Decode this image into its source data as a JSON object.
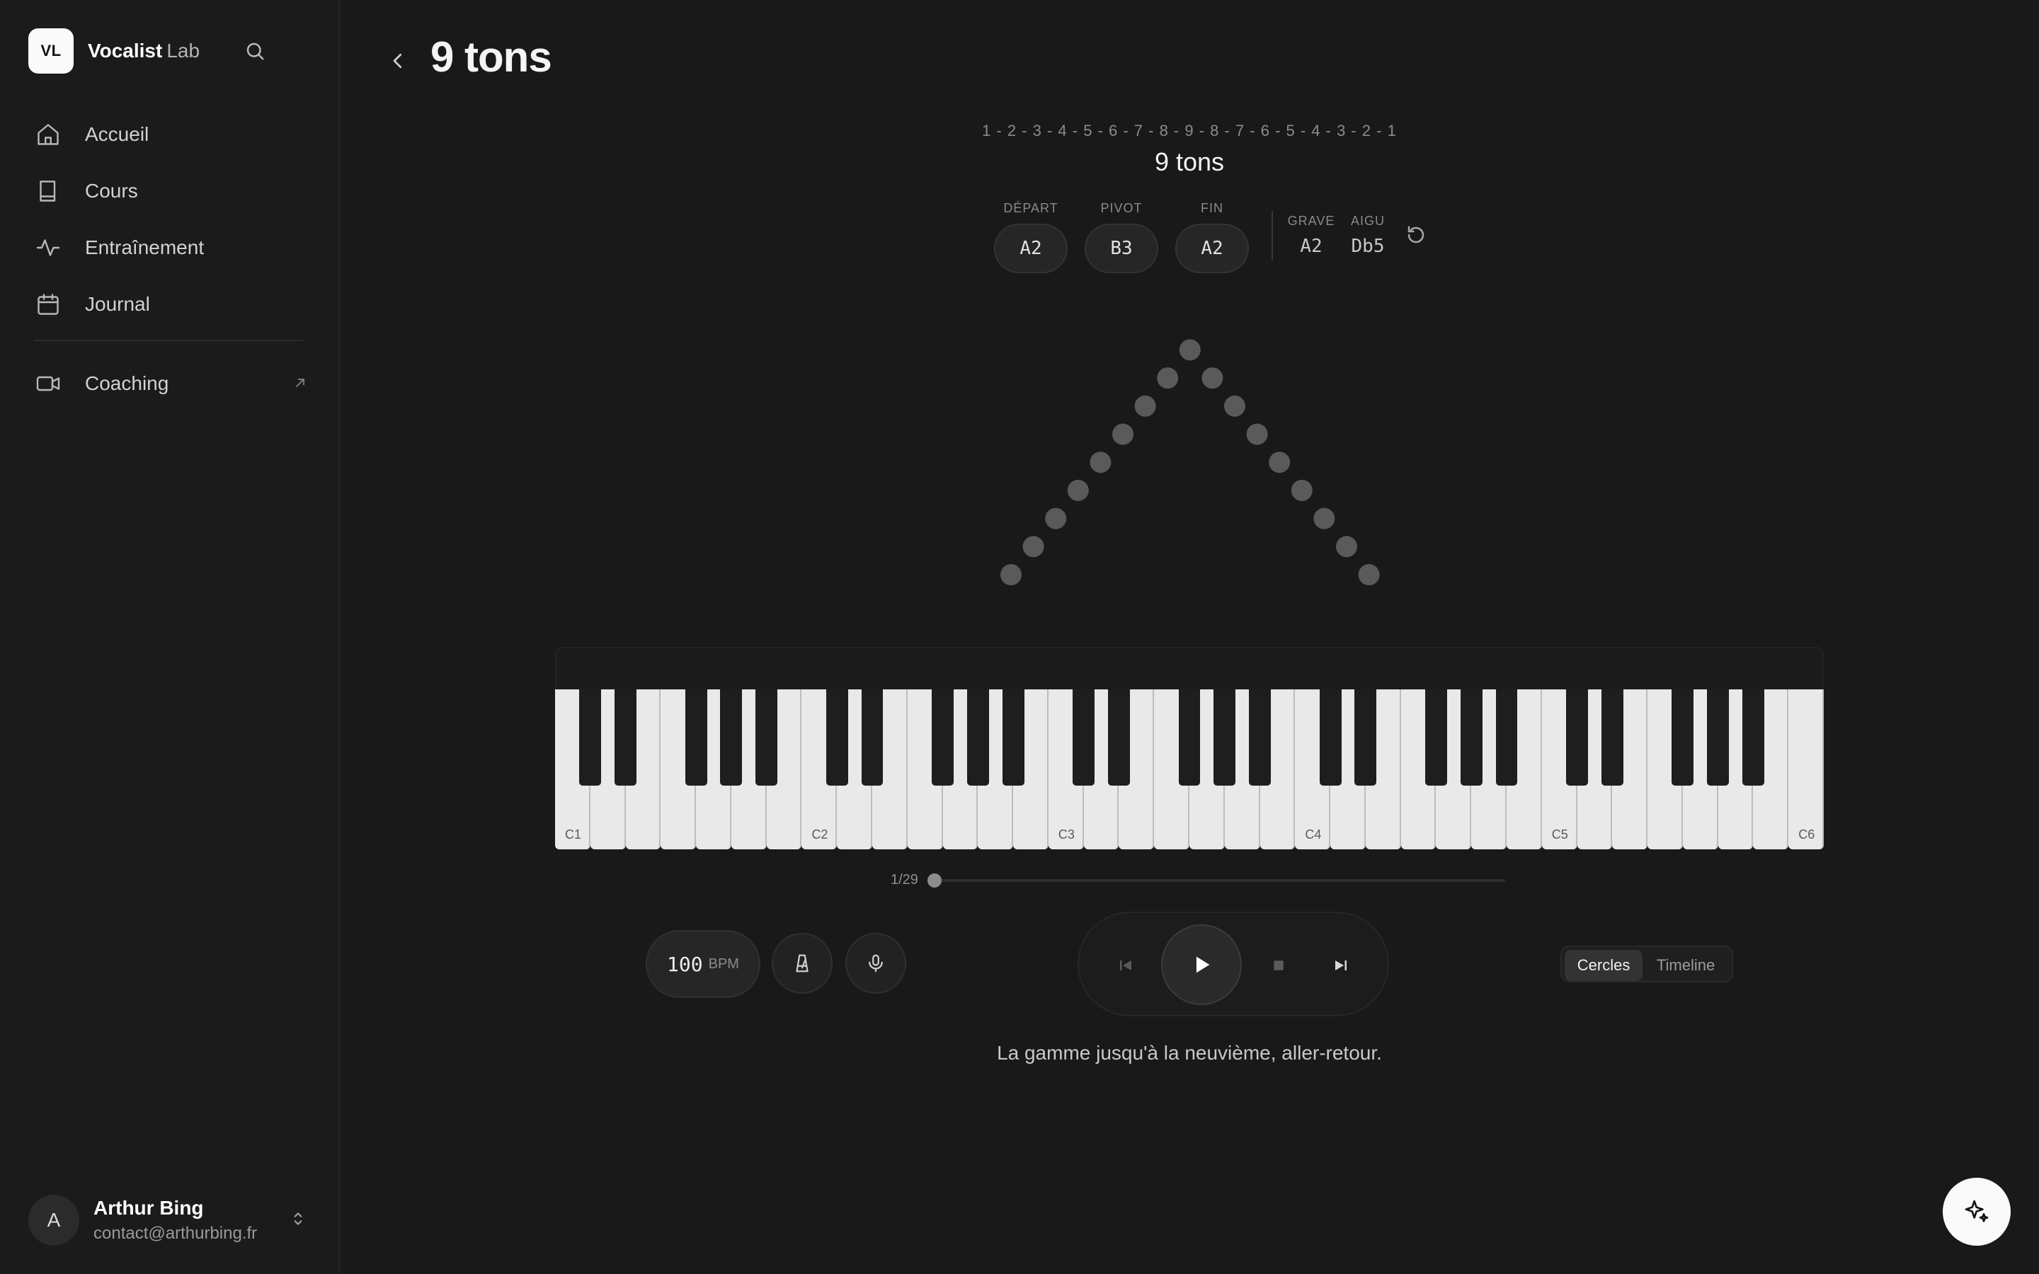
{
  "app": {
    "logo_text": "VL",
    "name": "Vocalist",
    "name_suffix": "Lab"
  },
  "sidebar": {
    "items": [
      {
        "label": "Accueil",
        "icon": "home-icon"
      },
      {
        "label": "Cours",
        "icon": "book-icon"
      },
      {
        "label": "Entraînement",
        "icon": "activity-icon"
      },
      {
        "label": "Journal",
        "icon": "calendar-icon"
      }
    ],
    "coaching": {
      "label": "Coaching",
      "icon": "video-icon",
      "external_icon": "arrow-up-right-icon"
    }
  },
  "user": {
    "initial": "A",
    "name": "Arthur Bing",
    "email": "contact@arthurbing.fr"
  },
  "header": {
    "title": "9 tons"
  },
  "exercise": {
    "sequence": "1 - 2 - 3 - 4 - 5 - 6 - 7 - 8 - 9 - 8 - 7 - 6 - 5 - 4 - 3 - 2 - 1",
    "name": "9 tons",
    "depart_label": "DÉPART",
    "depart_value": "A2",
    "pivot_label": "PIVOT",
    "pivot_value": "B3",
    "fin_label": "FIN",
    "fin_value": "A2",
    "grave_label": "GRAVE",
    "grave_value": "A2",
    "aigu_label": "AIGU",
    "aigu_value": "Db5",
    "description": "La gamme jusqu'à la neuvième, aller-retour."
  },
  "pattern": {
    "degrees": [
      1,
      2,
      3,
      4,
      5,
      6,
      7,
      8,
      9,
      8,
      7,
      6,
      5,
      4,
      3,
      2,
      1
    ],
    "color": "#5a5a5a"
  },
  "piano": {
    "octave_labels": [
      "C1",
      "C2",
      "C3",
      "C4",
      "C5",
      "C6"
    ]
  },
  "progress": {
    "label": "1/29",
    "current": 1,
    "total": 29
  },
  "controls": {
    "bpm_value": "100",
    "bpm_unit": "BPM",
    "metronome_icon": "metronome-icon",
    "mic_icon": "microphone-icon"
  },
  "view_toggle": {
    "options": [
      "Cercles",
      "Timeline"
    ],
    "selected": "Cercles"
  },
  "colors": {
    "background": "#191919",
    "sidebar": "#1b1b1b",
    "accent": "#fafafa"
  }
}
